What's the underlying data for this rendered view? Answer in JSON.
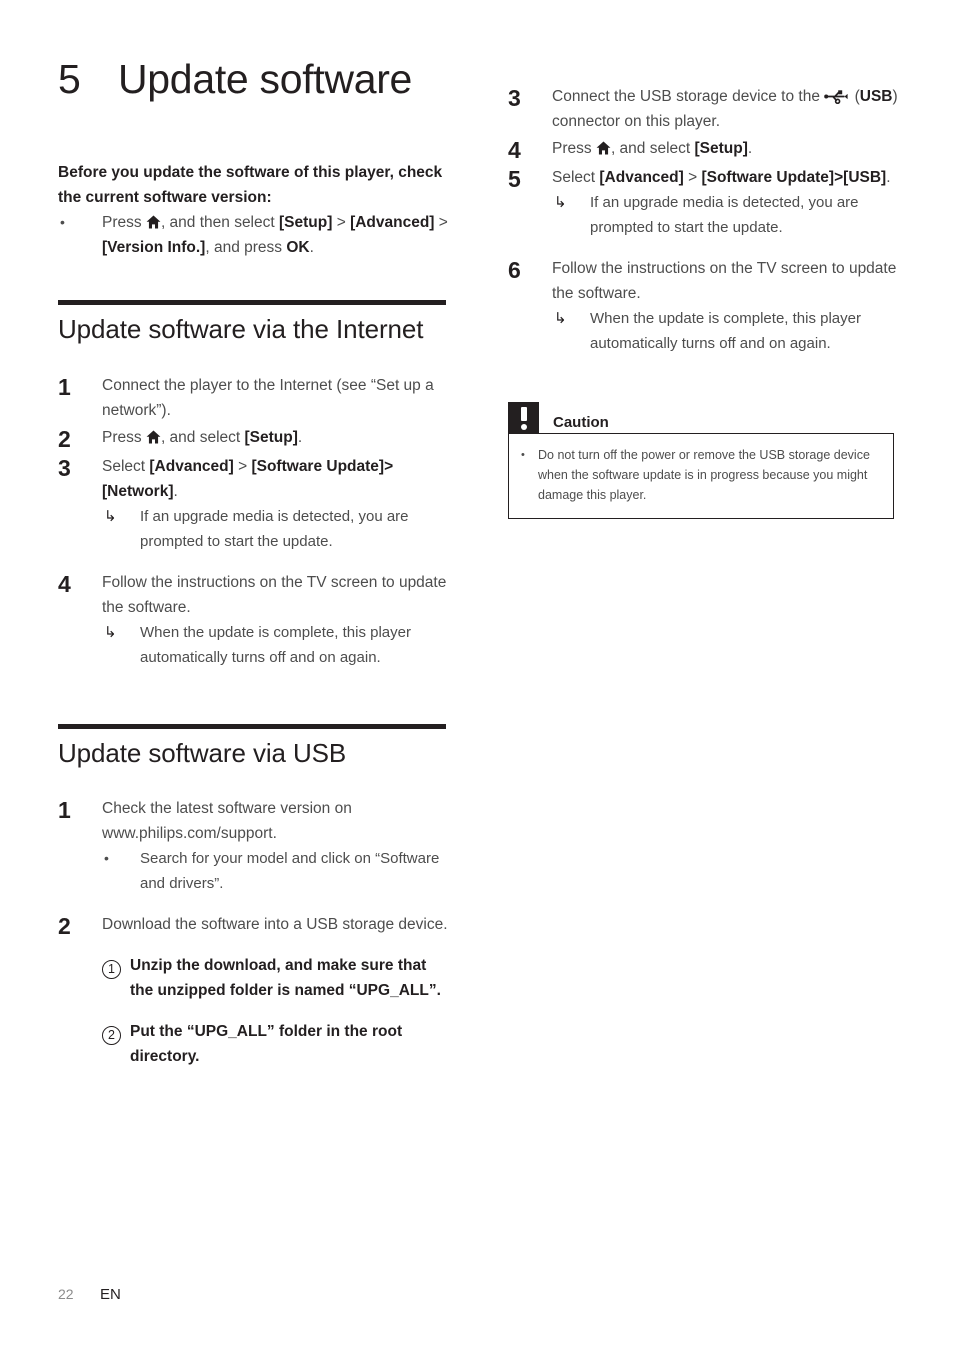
{
  "document": {
    "chapter_number": "5",
    "chapter_title": "Update software",
    "footer": {
      "page_number": "22",
      "language": "EN"
    }
  },
  "intro": {
    "paragraph": "Before you update the software of this player, check the current software version:",
    "bullet": {
      "dot": "•",
      "pre_icon_text": "Press ",
      "icon": "home-icon",
      "seg1": ", and then select ",
      "bold1": "[Setup]",
      "seg2": " > ",
      "bold2": "[Advanced]",
      "seg3": " > ",
      "bold3": "[Version Info.]",
      "seg4": ", and press ",
      "bold4": "OK",
      "seg5": "."
    }
  },
  "section_internet": {
    "heading": "Update software via the Internet",
    "steps": [
      {
        "number": "1",
        "text": "Connect the player to the Internet (see “Set up a network”)."
      },
      {
        "number": "2",
        "pre_icon_text": "Press ",
        "icon": "home-icon",
        "seg1": ", and select ",
        "bold1": "[Setup]",
        "seg2": "."
      },
      {
        "number": "3",
        "seg1": "Select ",
        "bold1": "[Advanced]",
        "seg2": " > ",
        "bold2": "[Software Update]",
        "seg3": ">",
        "bold3": "[Network]",
        "seg4": ".",
        "subbullet": {
          "arrow": "↳",
          "text": "If an upgrade media is detected, you are prompted to start the update."
        }
      },
      {
        "number": "4",
        "text": "Follow the instructions on the TV screen to update the software.",
        "subbullet": {
          "arrow": "↳",
          "text": "When the update is complete, this player automatically turns off and on again."
        }
      }
    ]
  },
  "section_usb": {
    "heading": "Update software via USB",
    "steps": [
      {
        "number": "1",
        "text": "Check the latest software version on www.philips.com/support.",
        "bullet": {
          "dot": "•",
          "text": "Search for your model and click on “Software and drivers”."
        }
      },
      {
        "number": "2",
        "text": "Download the software into a USB storage device.",
        "circled_items": [
          {
            "num": "1",
            "text": "Unzip the download, and make sure that the unzipped folder is named “UPG_ALL”."
          },
          {
            "num": "2",
            "text": "Put the “UPG_ALL” folder in the root directory."
          }
        ]
      },
      {
        "number": "3",
        "seg1": "Connect the USB storage device to the ",
        "icon": "usb-icon",
        "seg2": " (",
        "bold1": "USB",
        "seg3": ") connector on this player."
      },
      {
        "number": "4",
        "pre_icon_text": "Press ",
        "icon": "home-icon",
        "seg1": ", and select ",
        "bold1": "[Setup]",
        "seg2": "."
      },
      {
        "number": "5",
        "seg1": "Select ",
        "bold1": "[Advanced]",
        "seg2": " > ",
        "bold2": "[Software Update]",
        "seg3": ">",
        "bold3": "[USB]",
        "seg4": ".",
        "subbullet": {
          "arrow": "↳",
          "text": "If an upgrade media is detected, you are prompted to start the update."
        }
      },
      {
        "number": "6",
        "text": "Follow the instructions on the TV screen to update the software.",
        "subbullet": {
          "arrow": "↳",
          "text": "When the update is complete, this player automatically turns off and on again."
        }
      }
    ]
  },
  "caution": {
    "label": "Caution",
    "icon": "exclamation-icon",
    "items": [
      {
        "dot": "•",
        "text": "Do not turn off the power or remove the USB storage device when the software update is in progress because you might damage this player."
      }
    ]
  },
  "colors": {
    "ink": "#231f20",
    "body": "#4d4d4d",
    "muted": "#8c8c8c"
  }
}
